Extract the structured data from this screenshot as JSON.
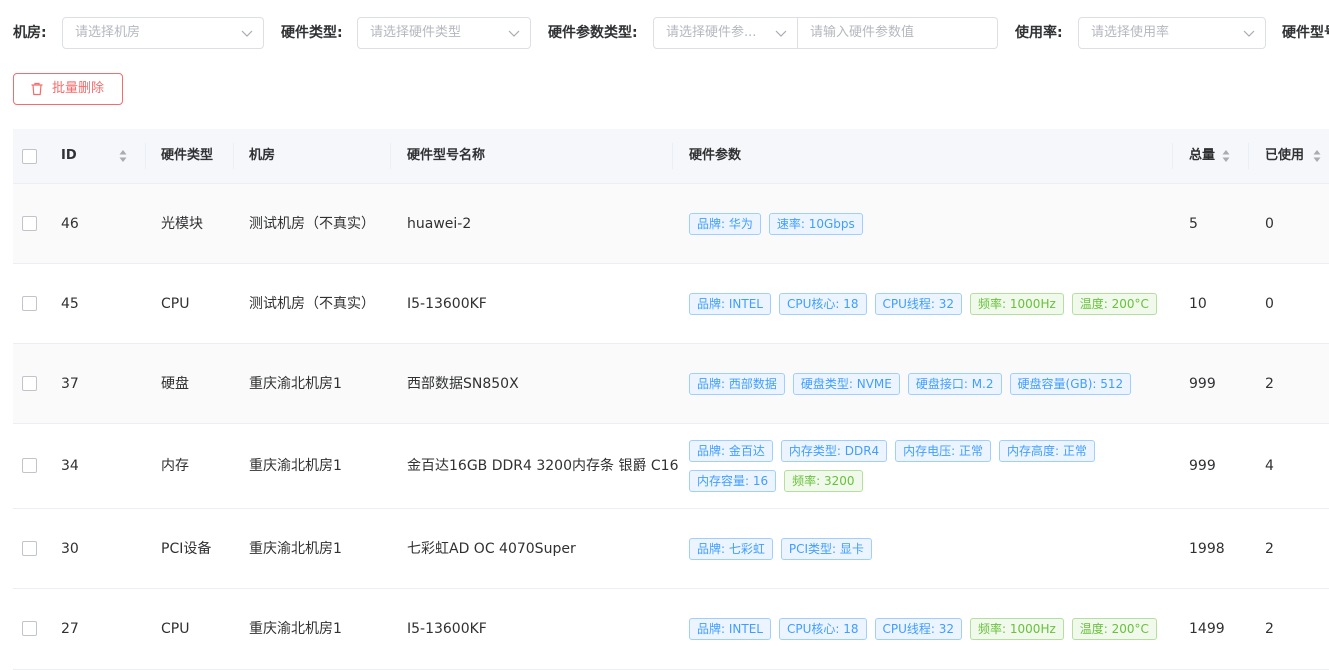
{
  "filters": {
    "room_label": "机房:",
    "room_placeholder": "请选择机房",
    "hwtype_label": "硬件类型:",
    "hwtype_placeholder": "请选择硬件类型",
    "param_label": "硬件参数类型:",
    "param_type_placeholder": "请选择硬件参...",
    "param_value_placeholder": "请输入硬件参数值",
    "usage_label": "使用率:",
    "usage_placeholder": "请选择使用率",
    "model_label": "硬件型号"
  },
  "toolbar": {
    "batch_delete_label": "批量删除"
  },
  "table": {
    "headers": {
      "id": "ID",
      "type": "硬件类型",
      "room": "机房",
      "model": "硬件型号名称",
      "params": "硬件参数",
      "total": "总量",
      "used": "已使用"
    },
    "rows": [
      {
        "id": "46",
        "type": "光模块",
        "room": "测试机房（不真实）",
        "model": "huawei-2",
        "tag_lines": [
          [
            {
              "text": "品牌: 华为",
              "color": "blue"
            },
            {
              "text": "速率: 10Gbps",
              "color": "blue"
            }
          ]
        ],
        "total": "5",
        "used": "0"
      },
      {
        "id": "45",
        "type": "CPU",
        "room": "测试机房（不真实）",
        "model": "I5-13600KF",
        "tag_lines": [
          [
            {
              "text": "品牌: INTEL",
              "color": "blue"
            },
            {
              "text": "CPU核心: 18",
              "color": "blue"
            },
            {
              "text": "CPU线程: 32",
              "color": "blue"
            },
            {
              "text": "频率: 1000Hz",
              "color": "green"
            },
            {
              "text": "温度: 200°C",
              "color": "green"
            }
          ]
        ],
        "total": "10",
        "used": "0"
      },
      {
        "id": "37",
        "type": "硬盘",
        "room": "重庆渝北机房1",
        "model": "西部数据SN850X",
        "tag_lines": [
          [
            {
              "text": "品牌: 西部数据",
              "color": "blue"
            },
            {
              "text": "硬盘类型: NVME",
              "color": "blue"
            },
            {
              "text": "硬盘接口: M.2",
              "color": "blue"
            },
            {
              "text": "硬盘容量(GB): 512",
              "color": "blue"
            }
          ]
        ],
        "total": "999",
        "used": "2"
      },
      {
        "id": "34",
        "type": "内存",
        "room": "重庆渝北机房1",
        "model": "金百达16GB DDR4 3200内存条 银爵 C16",
        "tag_lines": [
          [
            {
              "text": "品牌: 金百达",
              "color": "blue"
            },
            {
              "text": "内存类型: DDR4",
              "color": "blue"
            },
            {
              "text": "内存电压: 正常",
              "color": "blue"
            },
            {
              "text": "内存高度: 正常",
              "color": "blue"
            }
          ],
          [
            {
              "text": "内存容量: 16",
              "color": "blue"
            },
            {
              "text": "频率: 3200",
              "color": "green"
            }
          ]
        ],
        "total": "999",
        "used": "4"
      },
      {
        "id": "30",
        "type": "PCI设备",
        "room": "重庆渝北机房1",
        "model": "七彩虹AD OC 4070Super",
        "tag_lines": [
          [
            {
              "text": "品牌: 七彩虹",
              "color": "blue"
            },
            {
              "text": "PCI类型: 显卡",
              "color": "blue"
            }
          ]
        ],
        "total": "1998",
        "used": "2"
      },
      {
        "id": "27",
        "type": "CPU",
        "room": "重庆渝北机房1",
        "model": "I5-13600KF",
        "tag_lines": [
          [
            {
              "text": "品牌: INTEL",
              "color": "blue"
            },
            {
              "text": "CPU核心: 18",
              "color": "blue"
            },
            {
              "text": "CPU线程: 32",
              "color": "blue"
            },
            {
              "text": "频率: 1000Hz",
              "color": "green"
            },
            {
              "text": "温度: 200°C",
              "color": "green"
            }
          ]
        ],
        "total": "1499",
        "used": "2"
      }
    ]
  },
  "colors": {
    "danger": "#f56c6c",
    "tag_blue": "#409eff",
    "tag_green": "#67c23a",
    "border": "#dcdfe6"
  },
  "icons": {
    "select_arrow": "chevron-down-icon",
    "batch_delete": "trash-icon",
    "sort": "sort-caret-icon"
  }
}
